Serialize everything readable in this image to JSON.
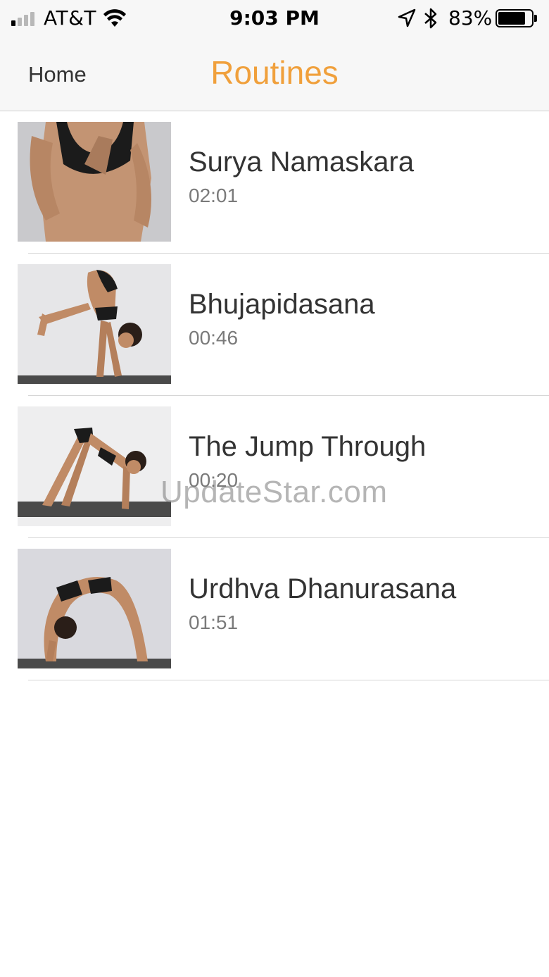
{
  "status_bar": {
    "carrier": "AT&T",
    "time": "9:03 PM",
    "battery_percent": "83%",
    "battery_level": 0.83,
    "signal_bars": 4,
    "signal_bars_active": 1,
    "icons": [
      "signal-icon",
      "wifi-icon",
      "location-icon",
      "bluetooth-icon",
      "battery-icon"
    ]
  },
  "nav": {
    "back_label": "Home",
    "title": "Routines",
    "title_color": "#f0a03c"
  },
  "routines": [
    {
      "name": "Surya Namaskara",
      "duration": "02:01"
    },
    {
      "name": "Bhujapidasana",
      "duration": "00:46"
    },
    {
      "name": "The Jump Through",
      "duration": "00:20"
    },
    {
      "name": "Urdhva Dhanurasana",
      "duration": "01:51"
    }
  ],
  "watermark": "UpdateStar.com"
}
